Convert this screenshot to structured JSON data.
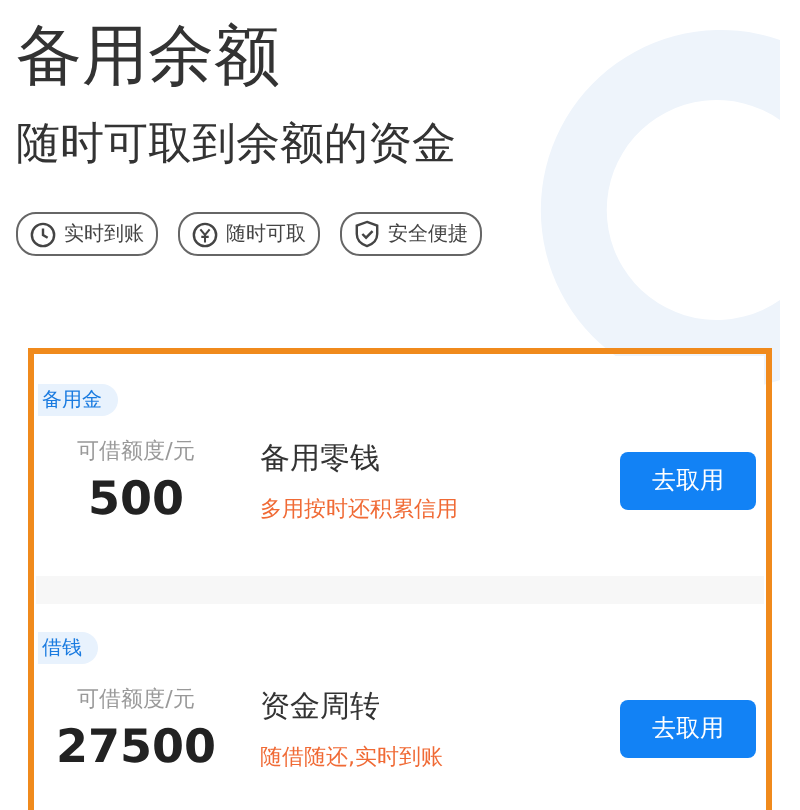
{
  "header": {
    "title": "备用余额",
    "subtitle": "随时可取到余额的资金"
  },
  "features": [
    {
      "kind": "clock",
      "label": "实时到账"
    },
    {
      "kind": "coin",
      "label": "随时可取"
    },
    {
      "kind": "shield",
      "label": "安全便捷"
    }
  ],
  "products": [
    {
      "tag": "备用金",
      "limit_label": "可借额度/元",
      "amount": "500",
      "name": "备用零钱",
      "slogan": "多用按时还积累信用",
      "button": "去取用"
    },
    {
      "tag": "借钱",
      "limit_label": "可借额度/元",
      "amount": "27500",
      "name": "资金周转",
      "slogan": "随借随还,实时到账",
      "button": "去取用"
    }
  ]
}
